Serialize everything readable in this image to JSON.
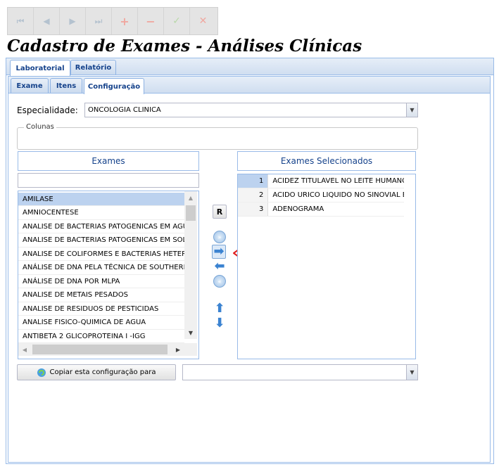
{
  "toolbar": {
    "buttons": [
      {
        "name": "first-icon",
        "glyph": "⏮"
      },
      {
        "name": "prev-icon",
        "glyph": "◀"
      },
      {
        "name": "next-icon",
        "glyph": "▶"
      },
      {
        "name": "last-icon",
        "glyph": "⏭"
      },
      {
        "name": "add-icon",
        "glyph": "+"
      },
      {
        "name": "remove-icon",
        "glyph": "−"
      },
      {
        "name": "confirm-icon",
        "glyph": "✓"
      },
      {
        "name": "cancel-icon",
        "glyph": "✕"
      }
    ]
  },
  "page": {
    "title": "Cadastro de Exames - Análises Clínicas"
  },
  "tabs_top": [
    {
      "label": "Laboratorial",
      "active": true
    },
    {
      "label": "Relatório",
      "active": false
    }
  ],
  "tabs_sub": [
    {
      "label": "Exame",
      "active": false
    },
    {
      "label": "Itens",
      "active": false
    },
    {
      "label": "Configuração",
      "active": true
    }
  ],
  "form": {
    "especialidade_label": "Especialidade:",
    "especialidade_value": "ONCOLOGIA CLINICA",
    "colunas_legend": "Colunas"
  },
  "exames": {
    "header": "Exames",
    "filter_value": "",
    "items": [
      "AMILASE",
      "AMNIOCENTESE",
      "ANALISE DE BACTERIAS PATOGENICAS EM AGUA",
      "ANALISE DE BACTERIAS PATOGENICAS EM SOLO",
      "ANALISE DE COLIFORMES E BACTERIAS HETEROT",
      "ANÁLISE DE DNA PELA TÉCNICA DE SOUTHERN B",
      "ANÁLISE DE DNA POR MLPA",
      "ANALISE DE METAIS PESADOS",
      "ANALISE DE RESIDUOS DE PESTICIDAS",
      "ANALISE FISICO-QUIMICA DE AGUA",
      "ANTIBETA 2 GLICOPROTEINA I -IGG"
    ],
    "selected_index": 0
  },
  "selecionados": {
    "header": "Exames Selecionados",
    "rows": [
      {
        "num": "1",
        "text": "ACIDEZ TITULÁVEL NO LEITE HUMANO"
      },
      {
        "num": "2",
        "text": "ACIDO URICO LIQUIDO NO SINOVIAL E"
      },
      {
        "num": "3",
        "text": "ADENOGRAMA"
      }
    ],
    "selected_index": 0
  },
  "transfer": {
    "reset_label": "R"
  },
  "copy": {
    "button_label": "Copiar esta configuração para",
    "target_value": ""
  },
  "colors": {
    "accent": "#15428b",
    "border": "#99bbe8",
    "selection": "#bcd2ef",
    "annotation_arrow": "#e02020"
  }
}
